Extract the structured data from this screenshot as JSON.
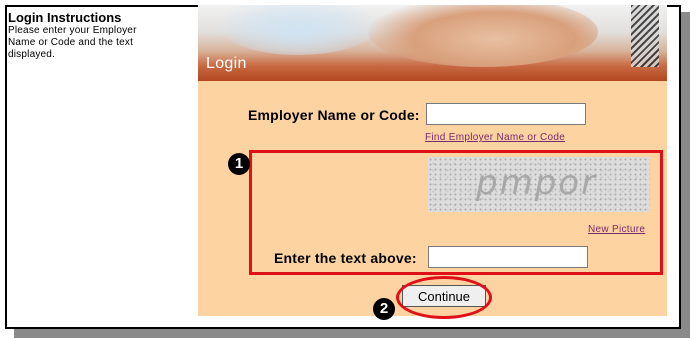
{
  "instructions": {
    "title": "Login Instructions",
    "line1": "Please enter your Employer",
    "line2": "Name or Code and the text",
    "line3": "displayed."
  },
  "banner": {
    "title": "Login"
  },
  "form": {
    "employer_label": "Employer Name or Code:",
    "employer_value": "",
    "find_link": "Find Employer Name or Code",
    "captcha_text": "pmpor",
    "new_picture_link": "New Picture",
    "text_label": "Enter the text above:",
    "text_value": "",
    "continue_label": "Continue"
  },
  "annotations": {
    "badge1": "1",
    "badge2": "2"
  },
  "colors": {
    "panel_bg": "#fdd3a2",
    "highlight_red": "#e01018",
    "link": "#7b2a6a"
  }
}
